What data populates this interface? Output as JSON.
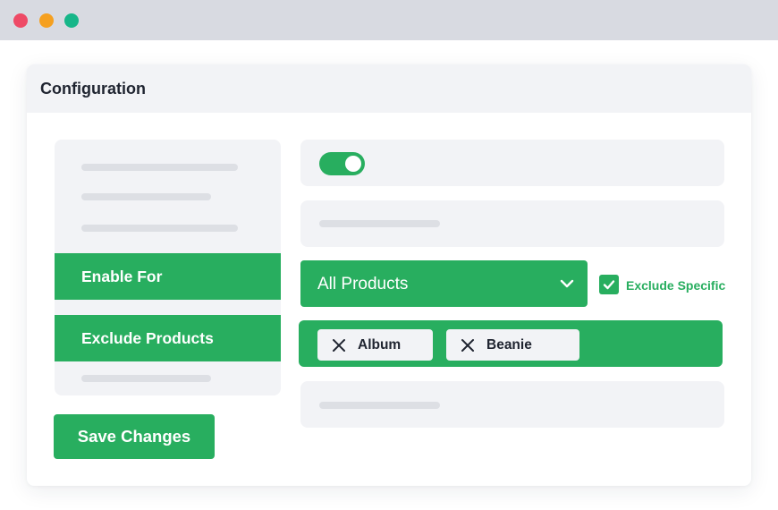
{
  "window": {
    "controls": [
      "close",
      "minimize",
      "maximize"
    ],
    "colors": {
      "close": "#ee4a66",
      "minimize": "#f5a020",
      "maximize": "#17b689"
    }
  },
  "panel": {
    "title": "Configuration"
  },
  "sidebar": {
    "items": [
      {
        "label": "Enable For",
        "active": true
      },
      {
        "label": "Exclude Products",
        "active": true
      }
    ]
  },
  "actions": {
    "save_label": "Save Changes"
  },
  "settings": {
    "enabled": true,
    "product_scope": "All Products",
    "exclude_specific": {
      "label": "Exclude Specific",
      "checked": true
    },
    "excluded_products": [
      {
        "label": "Album",
        "remove_icon": "close-icon"
      },
      {
        "label": "Beanie",
        "remove_icon": "close-icon"
      }
    ]
  },
  "theme": {
    "accent": "#28ae5f",
    "surface": "#f2f3f6",
    "placeholder": "#dddfe4",
    "text": "#1f2430"
  }
}
